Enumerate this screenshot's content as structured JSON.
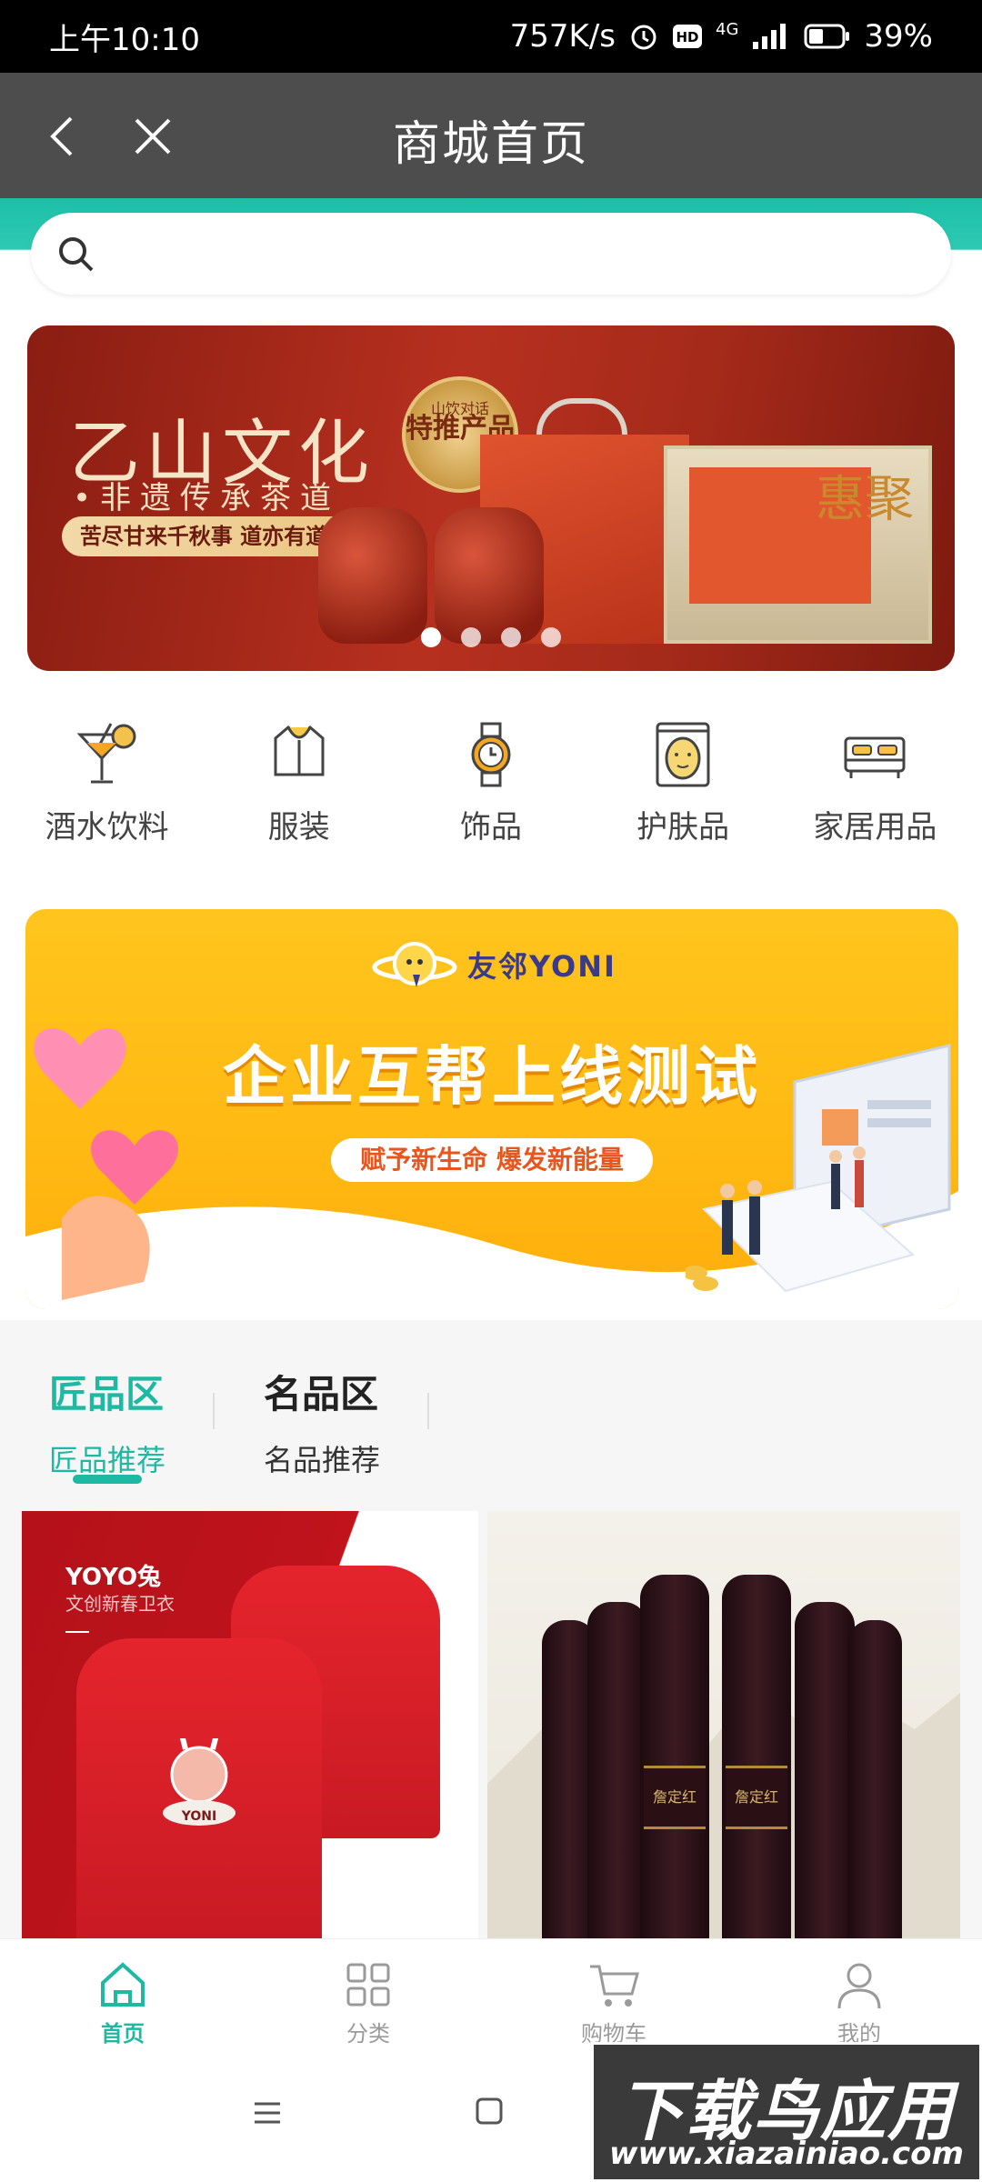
{
  "status_bar": {
    "time": "上午10:10",
    "speed": "757K/s",
    "network": "4G",
    "battery": "39%"
  },
  "nav": {
    "title": "商城首页"
  },
  "search": {
    "placeholder": ""
  },
  "banner1": {
    "title": "乙山文化",
    "subtitle": "•非遗传承茶道",
    "slogan": "苦尽甘来千秋事 道亦有道循世生",
    "seal_top": "山饮对话",
    "seal_main": "特推产品",
    "box_chars": "惠聚",
    "slide_count": 4,
    "active_slide": 0
  },
  "categories": [
    {
      "label": "酒水饮料",
      "icon": "cocktail-icon"
    },
    {
      "label": "服装",
      "icon": "jacket-icon"
    },
    {
      "label": "饰品",
      "icon": "watch-icon"
    },
    {
      "label": "护肤品",
      "icon": "face-mask-icon"
    },
    {
      "label": "家居用品",
      "icon": "bed-icon"
    }
  ],
  "banner2": {
    "brand": "友邻YONI",
    "title": "企业互帮上线测试",
    "slogan": "赋予新生命 爆发新能量"
  },
  "zone_tabs": [
    {
      "title": "匠品区",
      "subtitle": "匠品推荐",
      "active": true
    },
    {
      "title": "名品区",
      "subtitle": "名品推荐",
      "active": false
    }
  ],
  "products": [
    {
      "brand": "YOYO兔",
      "subtitle": "文创新春卫衣",
      "mascot_text": "YONI"
    },
    {
      "label_text": "詹定红"
    }
  ],
  "tabbar": [
    {
      "label": "首页",
      "icon": "home-icon",
      "active": true
    },
    {
      "label": "分类",
      "icon": "grid-icon",
      "active": false
    },
    {
      "label": "购物车",
      "icon": "cart-icon",
      "active": false
    },
    {
      "label": "我的",
      "icon": "user-icon",
      "active": false
    }
  ],
  "watermark": {
    "title": "下载鸟应用",
    "url": "www.xiazainiao.com"
  },
  "colors": {
    "accent": "#1db9a3",
    "nav_bg": "#4d4d4d",
    "banner1": "#b7301f",
    "banner2": "#ffb912"
  }
}
